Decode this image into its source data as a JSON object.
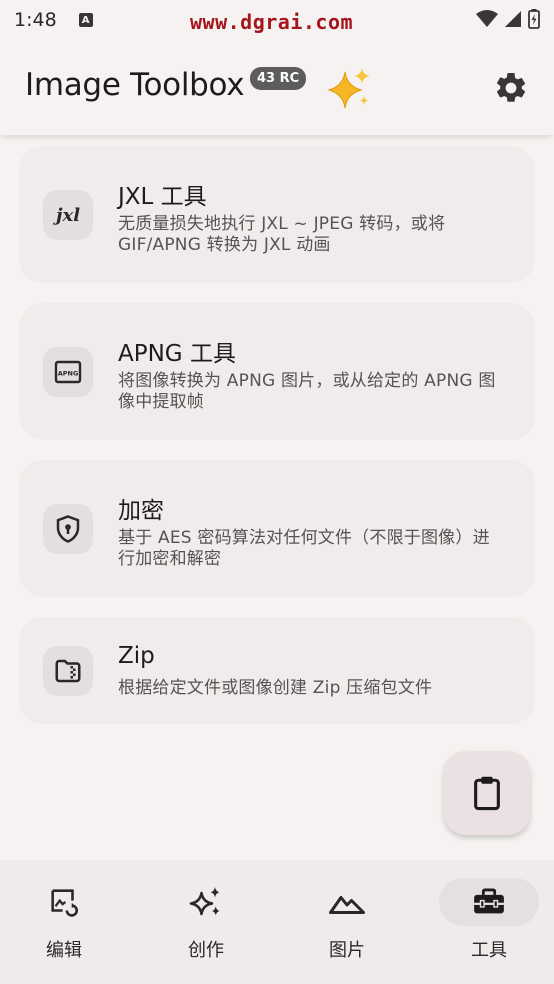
{
  "status_bar": {
    "time": "1:48",
    "notification_icon": "a-box-icon",
    "watermark": "www.dgrai.com"
  },
  "app_bar": {
    "title": "Image Toolbox",
    "badge": "43 RC"
  },
  "tools": [
    {
      "title": "JXL 工具",
      "description": "无质量损失地执行 JXL ~ JPEG 转码，或将 GIF/APNG 转换为 JXL 动画",
      "icon": "jxl-icon"
    },
    {
      "title": "APNG 工具",
      "description": "将图像转换为 APNG 图片，或从给定的 APNG 图像中提取帧",
      "icon": "apng-icon"
    },
    {
      "title": "加密",
      "description": "基于 AES 密码算法对任何文件（不限于图像）进行加密和解密",
      "icon": "shield-lock-icon"
    },
    {
      "title": "Zip",
      "description": "根据给定文件或图像创建 Zip 压缩包文件",
      "icon": "folder-zip-icon"
    }
  ],
  "nav": [
    {
      "label": "编辑",
      "icon": "image-edit-icon",
      "active": false
    },
    {
      "label": "创作",
      "icon": "sparkles-icon",
      "active": false
    },
    {
      "label": "图片",
      "icon": "landscape-icon",
      "active": false
    },
    {
      "label": "工具",
      "icon": "toolbox-icon",
      "active": true
    }
  ],
  "colors": {
    "background": "#f6f2f1",
    "card": "#f1eceb",
    "icon_box": "#e4dede",
    "active_pill": "#e5dfdf",
    "watermark": "#a4151c"
  }
}
